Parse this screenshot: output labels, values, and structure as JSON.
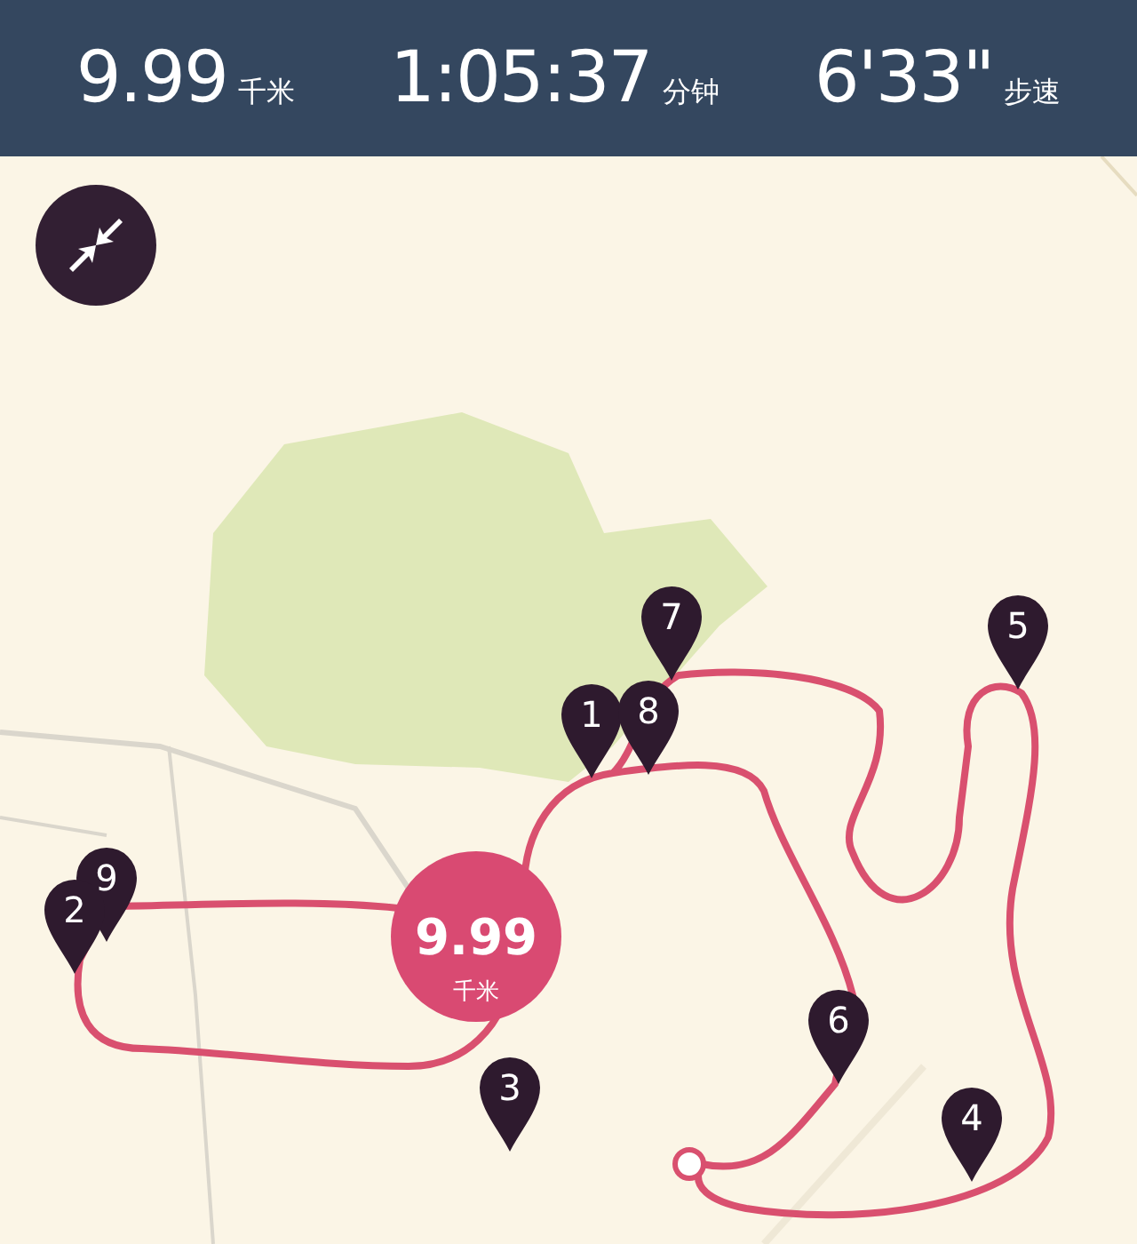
{
  "stats": [
    {
      "value": "9.99",
      "unit": "千米"
    },
    {
      "value": "1:05:37",
      "unit": "分钟"
    },
    {
      "value": "6'33\"",
      "unit": "步速"
    }
  ],
  "distance_badge": {
    "value": "9.99",
    "unit": "千米"
  },
  "pins": [
    {
      "label": "1"
    },
    {
      "label": "8"
    },
    {
      "label": "7"
    },
    {
      "label": "5"
    },
    {
      "label": "9"
    },
    {
      "label": "2"
    },
    {
      "label": "6"
    },
    {
      "label": "4"
    },
    {
      "label": "3"
    }
  ]
}
